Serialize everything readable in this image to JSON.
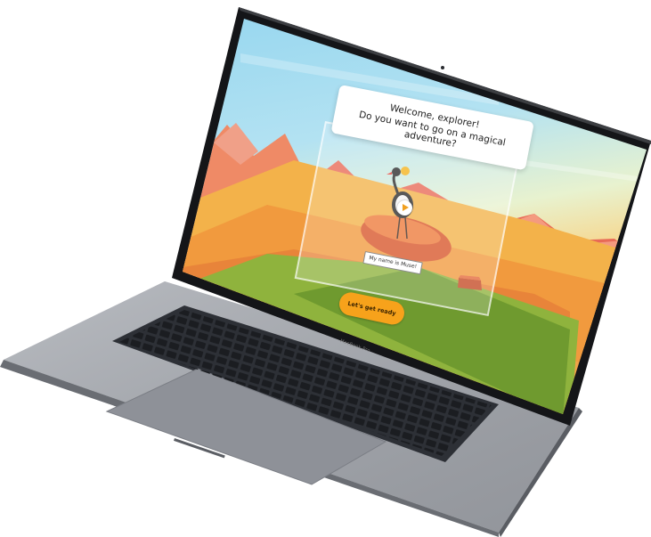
{
  "dialog": {
    "line1": "Welcome, explorer!",
    "line2": "Do you want to go on a magical adventure?"
  },
  "scene": {
    "name_tag": "My name is Muse!",
    "play_icon": "play-icon"
  },
  "actions": {
    "ready_label": "Let's get ready"
  },
  "device": {
    "brand_label": "MacBook Pro"
  },
  "colors": {
    "accent": "#f7a21b",
    "sky": "#9fdcf2",
    "desert": "#f2a64a",
    "rock": "#d9592a",
    "grass": "#7aa33a",
    "laptop_body": "#3c3f45"
  }
}
